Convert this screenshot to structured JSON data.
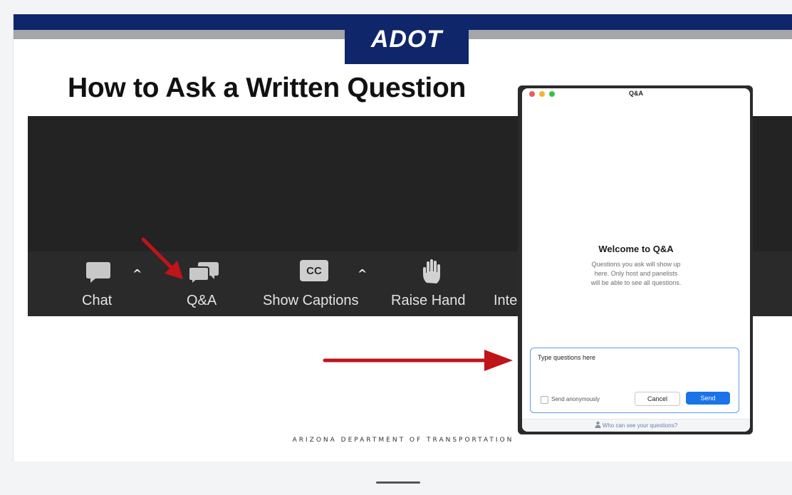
{
  "slide": {
    "logo": "ADOT",
    "title": "How to Ask a Written Question",
    "footer": "ARIZONA DEPARTMENT OF TRANSPORTATION"
  },
  "toolbar": {
    "chat_label": "Chat",
    "qa_label": "Q&A",
    "captions_icon_text": "CC",
    "captions_label": "Show Captions",
    "raise_hand_label": "Raise Hand",
    "truncated_label": "Inte",
    "caret": "^"
  },
  "qa_dialog": {
    "title": "Q&A",
    "welcome_heading": "Welcome to Q&A",
    "welcome_line1": "Questions you ask will show up",
    "welcome_line2": "here. Only host and panelists",
    "welcome_line3": "will be able to see all questions.",
    "input_value": "Type questions here",
    "anonymous_label": "Send anonymously",
    "cancel_label": "Cancel",
    "send_label": "Send",
    "who_can_see": "Who can see your questions?"
  },
  "colors": {
    "adot_blue": "#10266a",
    "band_gray": "#a4a6a9",
    "toolbar_dark": "#2a2a2a",
    "arrow_red": "#c0141b",
    "send_blue": "#1a73e8"
  },
  "icons": [
    "chat-bubble-icon",
    "qa-bubbles-icon",
    "cc-icon",
    "raise-hand-icon",
    "caret-up-icon",
    "person-icon"
  ]
}
